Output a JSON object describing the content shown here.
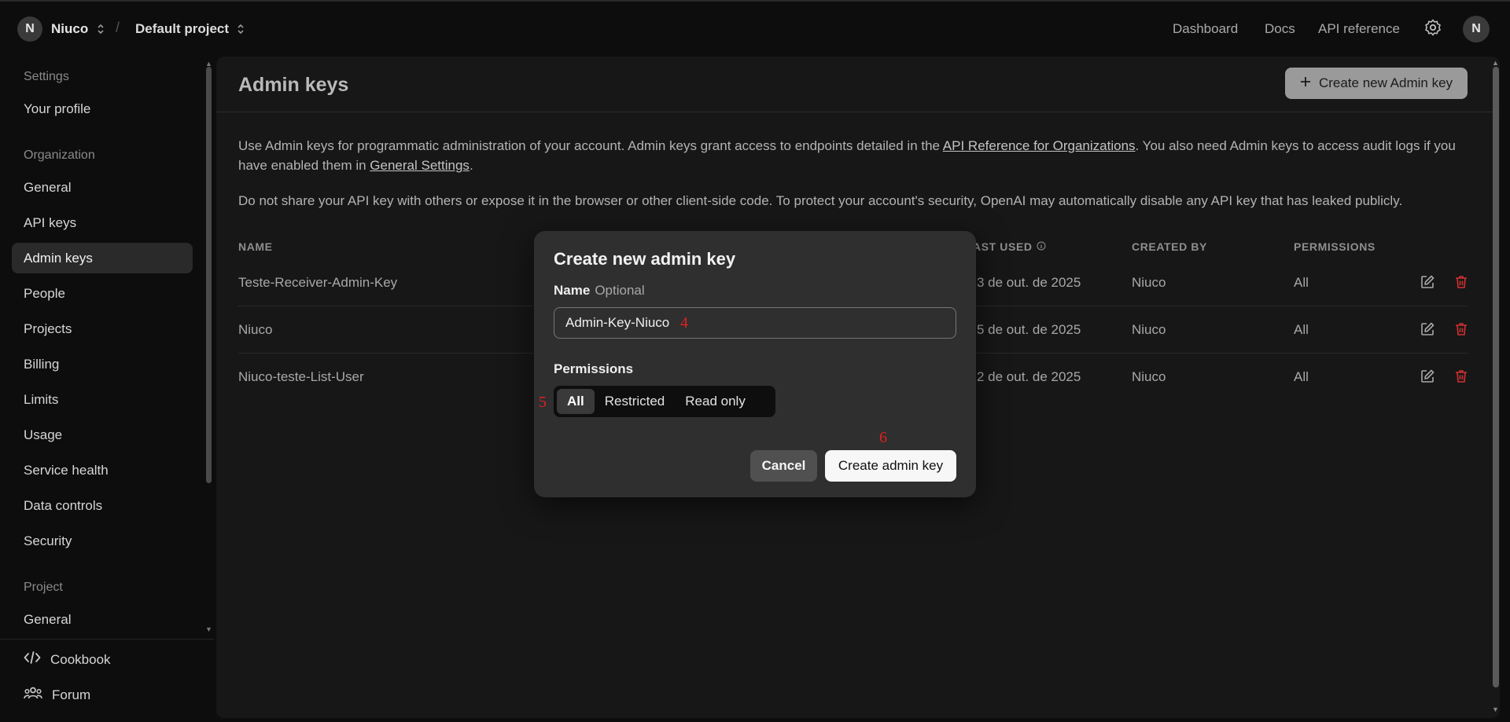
{
  "topbar": {
    "org_initial": "N",
    "org_name": "Niuco",
    "separator": "/",
    "project_name": "Default project",
    "links": [
      "Dashboard",
      "Docs",
      "API reference"
    ],
    "user_initial": "N"
  },
  "sidebar": {
    "sections": {
      "settings": "Settings",
      "organization": "Organization",
      "project": "Project"
    },
    "items": {
      "profile": "Your profile",
      "general": "General",
      "api_keys": "API keys",
      "admin_keys": "Admin keys",
      "people": "People",
      "projects": "Projects",
      "billing": "Billing",
      "limits": "Limits",
      "usage": "Usage",
      "service_health": "Service health",
      "data_controls": "Data controls",
      "security": "Security",
      "project_general": "General"
    },
    "footer": {
      "cookbook": "Cookbook",
      "forum": "Forum"
    }
  },
  "main": {
    "title": "Admin keys",
    "create_button": "Create new Admin key",
    "desc1_a": "Use Admin keys for programmatic administration of your account. Admin keys grant access to endpoints detailed in the ",
    "desc1_link": "API Reference for Organizations",
    "desc1_b": ". You also need Admin keys to access audit logs if you have enabled them in ",
    "desc1_link2": "General Settings",
    "desc1_c": ".",
    "desc2": "Do not share your API key with others or expose it in the browser or other client-side code. To protect your account's security, OpenAI may automatically disable any API key that has leaked publicly.",
    "table": {
      "headers": {
        "name": "NAME",
        "last_used": "AST USED",
        "created_by": "CREATED BY",
        "permissions": "PERMISSIONS"
      },
      "rows": [
        {
          "name": "Teste-Receiver-Admin-Key",
          "last_used": "3 de out. de 2025",
          "created_by": "Niuco",
          "permissions": "All"
        },
        {
          "name": "Niuco",
          "last_used": "5 de out. de 2025",
          "created_by": "Niuco",
          "permissions": "All"
        },
        {
          "name": "Niuco-teste-List-User",
          "last_used": "2 de out. de 2025",
          "created_by": "Niuco",
          "permissions": "All"
        }
      ]
    }
  },
  "modal": {
    "title": "Create new admin key",
    "name_label": "Name",
    "name_optional": "Optional",
    "name_value": "Admin-Key-Niuco",
    "permissions_label": "Permissions",
    "permission_options": [
      "All",
      "Restricted",
      "Read only"
    ],
    "selected_permission": "All",
    "cancel": "Cancel",
    "create": "Create admin key",
    "markers": [
      "4",
      "5",
      "6"
    ]
  },
  "colors": {
    "marker": "#e02020",
    "delete_icon": "#d03030"
  }
}
